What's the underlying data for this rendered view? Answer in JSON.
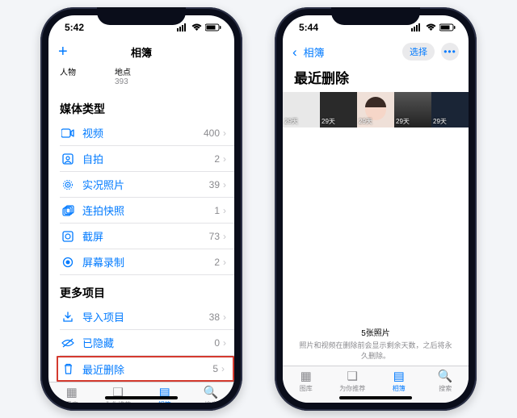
{
  "status": {
    "time_left": "5:42",
    "time_right": "5:44"
  },
  "left": {
    "title": "相簿",
    "sub": {
      "people": {
        "label": "人物"
      },
      "places": {
        "label": "地点",
        "count": "393"
      }
    },
    "section_media": "媒体类型",
    "media": [
      {
        "key": "video",
        "icon": "video",
        "label": "视频",
        "count": "400"
      },
      {
        "key": "selfie",
        "icon": "selfie",
        "label": "自拍",
        "count": "2"
      },
      {
        "key": "live",
        "icon": "live",
        "label": "实况照片",
        "count": "39"
      },
      {
        "key": "burst",
        "icon": "burst",
        "label": "连拍快照",
        "count": "1"
      },
      {
        "key": "screenshot",
        "icon": "screenshot",
        "label": "截屏",
        "count": "73"
      },
      {
        "key": "screenrec",
        "icon": "screenrec",
        "label": "屏幕录制",
        "count": "2"
      }
    ],
    "section_more": "更多项目",
    "more": [
      {
        "key": "imports",
        "icon": "import",
        "label": "导入项目",
        "count": "38"
      },
      {
        "key": "hidden",
        "icon": "hidden",
        "label": "已隐藏",
        "count": "0"
      },
      {
        "key": "deleted",
        "icon": "trash",
        "label": "最近删除",
        "count": "5",
        "highlight": true
      }
    ]
  },
  "right": {
    "back": "相簿",
    "select": "选择",
    "title": "最近删除",
    "thumb_badge": "29天",
    "footer_main": "5张照片",
    "footer_sub": "照片和视频在删除前会显示剩余天数，之后将永久删除。"
  },
  "tabs": [
    {
      "key": "library",
      "label": "图库"
    },
    {
      "key": "foryou",
      "label": "为你推荐"
    },
    {
      "key": "albums",
      "label": "相簿",
      "active": true
    },
    {
      "key": "search",
      "label": "搜索"
    }
  ]
}
